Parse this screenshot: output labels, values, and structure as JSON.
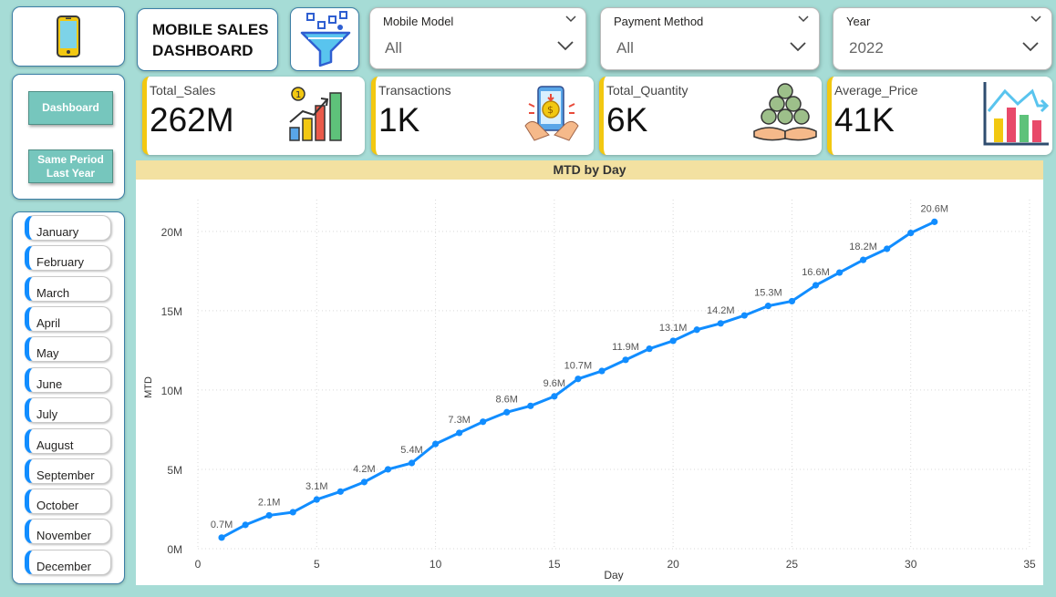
{
  "header": {
    "title_line1": "MOBILE SALES",
    "title_line2": "DASHBOARD",
    "phone_icon": "smartphone-icon",
    "filter_icon": "funnel-filter-icon"
  },
  "slicers": [
    {
      "label": "Mobile Model",
      "value": "All"
    },
    {
      "label": "Payment Method",
      "value": "All"
    },
    {
      "label": "Year",
      "value": "2022"
    }
  ],
  "nav": {
    "dashboard_label": "Dashboard",
    "same_period_label": "Same Period Last Year"
  },
  "months": [
    "January",
    "February",
    "March",
    "April",
    "May",
    "June",
    "July",
    "August",
    "September",
    "October",
    "November",
    "December"
  ],
  "kpis": [
    {
      "label": "Total_Sales",
      "value": "262M",
      "icon": "bar-chart-trophy-icon"
    },
    {
      "label": "Transactions",
      "value": "1K",
      "icon": "phone-payment-icon"
    },
    {
      "label": "Total_Quantity",
      "value": "6K",
      "icon": "coins-hands-icon"
    },
    {
      "label": "Average_Price",
      "value": "41K",
      "icon": "chart-arrow-icon"
    }
  ],
  "colors": {
    "background": "#a6dcd6",
    "accent_teal": "#76c6bd",
    "kpi_border": "#f2c811",
    "line": "#118dff",
    "chart_title_bg": "#f3e1a1"
  },
  "chart_data": {
    "type": "line",
    "title": "MTD by Day",
    "xlabel": "Day",
    "ylabel": "MTD",
    "xlim": [
      0,
      35
    ],
    "ylim": [
      0,
      22
    ],
    "x_ticks": [
      "0",
      "5",
      "10",
      "15",
      "20",
      "25",
      "30",
      "35"
    ],
    "y_ticks": [
      "0M",
      "5M",
      "10M",
      "15M",
      "20M"
    ],
    "grid": true,
    "series": [
      {
        "x": [
          1,
          2,
          3,
          4,
          5,
          6,
          7,
          8,
          9,
          10,
          11,
          12,
          13,
          14,
          15,
          16,
          17,
          18,
          19,
          20,
          21,
          22,
          23,
          24,
          25,
          26,
          27,
          28,
          29,
          30,
          31
        ],
        "values": [
          0.7,
          1.5,
          2.1,
          2.3,
          3.1,
          3.6,
          4.2,
          5.0,
          5.4,
          6.6,
          7.3,
          8.0,
          8.6,
          9.0,
          9.6,
          10.7,
          11.2,
          11.9,
          12.6,
          13.1,
          13.8,
          14.2,
          14.7,
          15.3,
          15.6,
          16.6,
          17.4,
          18.2,
          18.9,
          19.9,
          20.6
        ]
      }
    ],
    "data_labels": [
      {
        "x": 1,
        "text": "0.7M"
      },
      {
        "x": 3,
        "text": "2.1M"
      },
      {
        "x": 5,
        "text": "3.1M"
      },
      {
        "x": 7,
        "text": "4.2M"
      },
      {
        "x": 9,
        "text": "5.4M"
      },
      {
        "x": 11,
        "text": "7.3M"
      },
      {
        "x": 13,
        "text": "8.6M"
      },
      {
        "x": 15,
        "text": "9.6M"
      },
      {
        "x": 16,
        "text": "10.7M"
      },
      {
        "x": 18,
        "text": "11.9M"
      },
      {
        "x": 20,
        "text": "13.1M"
      },
      {
        "x": 22,
        "text": "14.2M"
      },
      {
        "x": 24,
        "text": "15.3M"
      },
      {
        "x": 26,
        "text": "16.6M"
      },
      {
        "x": 28,
        "text": "18.2M"
      },
      {
        "x": 31,
        "text": "20.6M"
      }
    ]
  }
}
